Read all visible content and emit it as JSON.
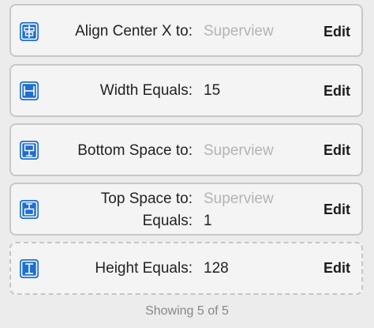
{
  "constraints": [
    {
      "icon": "align-center-x-icon",
      "label": "Align Center X to:",
      "value": "Superview",
      "edit": "Edit"
    },
    {
      "icon": "width-icon",
      "label": "Width Equals:",
      "value": "15",
      "edit": "Edit"
    },
    {
      "icon": "bottom-space-icon",
      "label": "Bottom Space to:",
      "value": "Superview",
      "edit": "Edit"
    },
    {
      "icon": "top-space-icon",
      "label": "Top Space to:",
      "value": "Superview",
      "label2": "Equals:",
      "value2": "1",
      "edit": "Edit"
    },
    {
      "icon": "height-icon",
      "label": "Height Equals:",
      "value": "128",
      "edit": "Edit"
    }
  ],
  "footer": "Showing 5 of 5",
  "colors": {
    "icon_blue": "#1f6fd0",
    "placeholder_text": "#b4b4b4"
  }
}
